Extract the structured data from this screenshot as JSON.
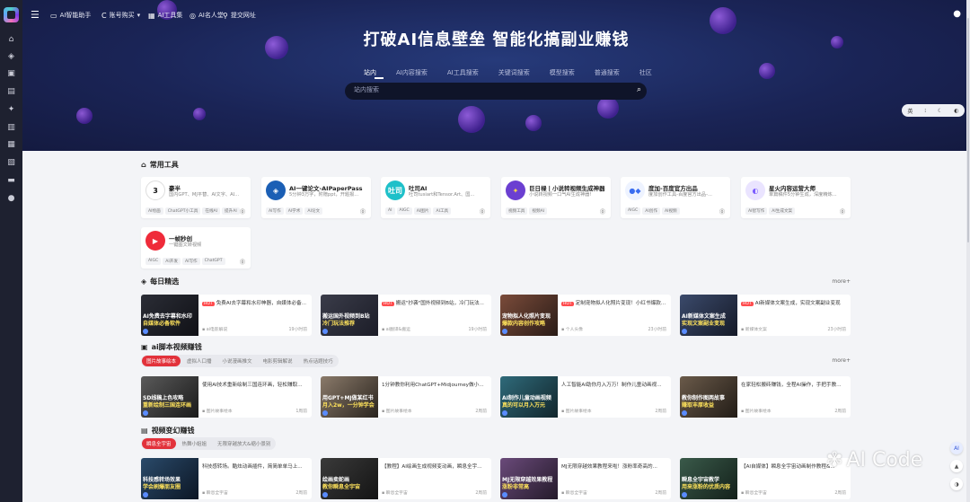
{
  "nav": {
    "items": [
      {
        "icon": "chat-icon",
        "label": "AI智能助手"
      },
      {
        "icon": "c-icon",
        "label": "账号购买",
        "caret": "▾"
      },
      {
        "icon": "grid-icon",
        "label": "AI工具集"
      },
      {
        "icon": "users-icon",
        "label": "AI名人堂"
      },
      {
        "icon": "link-icon",
        "label": "提交网址"
      }
    ]
  },
  "hero": {
    "title": "打破AI信息壁垒 智能化搞副业赚钱",
    "tabs": [
      "站内",
      "AI内容搜索",
      "AI工具搜索",
      "关键词搜索",
      "模型搜索",
      "普通搜索",
      "社区"
    ],
    "search_placeholder": "站内搜索"
  },
  "widget": {
    "items": [
      "英",
      "⁝",
      "☾",
      "◐"
    ]
  },
  "sections": {
    "tools_title": "常用工具",
    "daily_title": "每日精选",
    "daily_more": "more+",
    "video_title": "ai脚本视频赚钱",
    "video_more": "more+",
    "change_title": "视频变幻赚钱"
  },
  "tools": [
    {
      "name": "豪半",
      "desc": "国内GPT、MJ平替、AI文字、AI...",
      "tags": [
        "AI绘画",
        "ChatGPT小工具",
        "在线AI",
        "提升AI"
      ],
      "logo_text": "3",
      "logo_bg": "#ffffff",
      "logo_color": "#111111"
    },
    {
      "name": "AI一键论文-AIPaperPass",
      "desc": "5分钟3万字，附赠ppt，开题报...",
      "tags": [
        "AI写作",
        "AI学术",
        "AI论文"
      ],
      "logo_text": "◈",
      "logo_bg": "#1b5fb5",
      "logo_color": "#ffffff"
    },
    {
      "name": "吐司AI",
      "desc": "吐司tusiart和Tensor.Art、国...",
      "tags": [
        "AI",
        "AIGC",
        "AI图片",
        "AI工具"
      ],
      "logo_text": "吐司",
      "logo_bg": "#1ec0c9",
      "logo_color": "#ffffff"
    },
    {
      "name": "巨日禄丨小说转视频生成神器",
      "desc": "小说转视频一口气AI生成神器!",
      "tags": [
        "视频工具",
        "视频AI"
      ],
      "logo_text": "✦",
      "logo_bg": "#6b3fd1",
      "logo_color": "#ffd84a"
    },
    {
      "name": "度加-百度官方出品",
      "desc": "度加创作工具-百度官方出品-...",
      "tags": [
        "AIGC",
        "AI创作",
        "AI视频"
      ],
      "logo_text": "●◆",
      "logo_bg": "#eef3ff",
      "logo_color": "#3a6df0"
    },
    {
      "name": "星火内容运营大师",
      "desc": "单篇稿件5分钟生成，深度精炼...",
      "tags": [
        "AI智写作",
        "AI生成文案"
      ],
      "logo_text": "◐",
      "logo_bg": "#eae4ff",
      "logo_color": "#7b5cff"
    },
    {
      "name": "一帧秒创",
      "desc": "一键图文转视频",
      "tags": [
        "AIGC",
        "AI开发",
        "AI写作",
        "ChatGPT"
      ],
      "logo_text": "▶",
      "logo_bg": "#ef2b3a",
      "logo_color": "#ffffff"
    }
  ],
  "daily": [
    {
      "thumb_l1": "AI免费去字幕和水印",
      "thumb_l2": "自媒体必备软件",
      "title": "免费AI去字幕和水印神器，自媒体必备...",
      "hot": "HOT",
      "meta": "ai电影解说",
      "time": "19小时前"
    },
    {
      "thumb_l1": "搬运国外视频到B站",
      "thumb_l2": "冷门玩法推荐",
      "title": "搬运\"抄袭\"国外视频到B站，冷门玩法...",
      "hot": "HOT",
      "meta": "ai翻译&搬运",
      "time": "19小时前"
    },
    {
      "thumb_l1": "宠物拟人化照片变现",
      "thumb_l2": "爆款内容创作攻略",
      "title": "定制宠物拟人化照片变现！小红书爆款...",
      "hot": "HOT",
      "meta": "个人头像",
      "time": "23小时前"
    },
    {
      "thumb_l1": "AI新媒体文案生成",
      "thumb_l2": "实现文案副业变现",
      "title": "AI新媒体文案生成，实现文案副业变现",
      "hot": "HOT",
      "meta": "新媒体文案",
      "time": "23小时前"
    }
  ],
  "video": {
    "pills": [
      "图片故事绘本",
      "虚拟人口播",
      "小说漫画推文",
      "电影剪辑解说",
      "热点话题技巧"
    ],
    "posts": [
      {
        "thumb_l1": "SD线稿上色攻略",
        "thumb_l2": "重新绘制三国连环画",
        "title": "使用AI技术重新绘制三国连环画，轻松赚取...",
        "meta": "图片故事绘本",
        "time": "1周前"
      },
      {
        "thumb_l1": "用GPT+MJ做某红书",
        "thumb_l2": "月入2w，一分钟学会",
        "title": "1分钟教你利用ChatGPT+Midjourney做小红...",
        "meta": "图片故事绘本",
        "time": "2周前"
      },
      {
        "thumb_l1": "AI制作儿童动画视频",
        "thumb_l2": "真的可以月入万元",
        "title": "人工智能AI助你月入万万！制作儿童动画视...",
        "meta": "图片故事绘本",
        "time": "2周前"
      },
      {
        "thumb_l1": "教你制作图两故事",
        "thumb_l2": "赚取丰厚收益",
        "title": "在家轻松搬砖赚钱，全程AI操作，手把手教...",
        "meta": "图片故事绘本",
        "time": "2周前"
      }
    ]
  },
  "change": {
    "pills": [
      "瞬息全宇宙",
      "热舞小姐姐",
      "无限穿越放大&缩小景别"
    ],
    "posts": [
      {
        "thumb_l1": "科技感转场效果",
        "thumb_l2": "学会刷爆朋友圈",
        "title": "科技感转场。酷炫动画插件，简简单单马上...",
        "meta": "瞬息全宇宙",
        "time": "2周前"
      },
      {
        "thumb_l1": "绘画卖蛇画",
        "thumb_l2": "教你瞬息全宇宙",
        "title": "【教程】AI绘画生成视频变动画，瞬息全宇...",
        "meta": "瞬息全宇宙",
        "time": "2周前"
      },
      {
        "thumb_l1": "MJ无限穿越效果教程",
        "thumb_l2": "涨粉非常高",
        "title": "MJ无限穿越效果教程来啦！涨粉率奇高的...",
        "meta": "瞬息全宇宙",
        "time": "2周前"
      },
      {
        "thumb_l1": "瞬息全宇宙教学",
        "thumb_l2": "用来涨粉的优质内容",
        "title": "【AI自媒体】瞬息全宇宙动画制作教程&...",
        "meta": "瞬息全宇宙",
        "time": "2周前"
      }
    ]
  },
  "watermark": "AI Code",
  "right_float": [
    "AI",
    "▲",
    "◑"
  ]
}
